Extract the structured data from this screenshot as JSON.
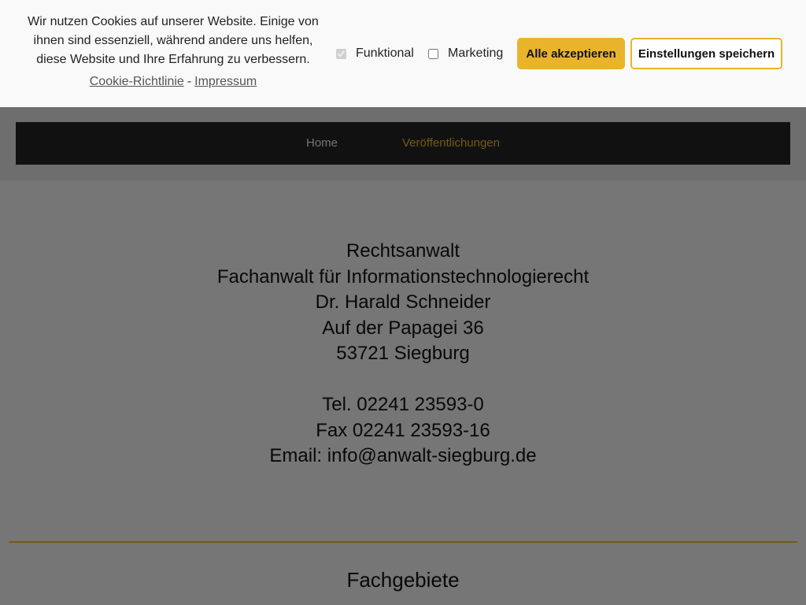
{
  "cookie_banner": {
    "text_lines": [
      "Wir nutzen Cookies auf unserer Website. Einige von",
      "ihnen sind essenziell, während andere uns helfen,",
      "diese Website und Ihre Erfahrung zu verbessern."
    ],
    "links": {
      "policy": "Cookie-Richtlinie",
      "separator": "-",
      "imprint": "Impressum"
    },
    "options": {
      "functional": {
        "label": "Funktional",
        "checked": true,
        "disabled": true
      },
      "marketing": {
        "label": "Marketing",
        "checked": false
      }
    },
    "buttons": {
      "accept_all": "Alle akzeptieren",
      "save_settings": "Einstellungen speichern"
    }
  },
  "nav": {
    "home": "Home",
    "publications": "Veröffentlichungen"
  },
  "contact": {
    "title": "Rechtsanwalt",
    "specialty": "Fachanwalt für Informationstechnologierecht",
    "name": "Dr. Harald Schneider",
    "street": "Auf der Papagei 36",
    "city": "53721 Siegburg",
    "phone": "Tel. 02241 23593-0",
    "fax": "Fax 02241 23593-16",
    "email": "Email: info@anwalt-siegburg.de"
  },
  "sections": {
    "fields_title": "Fachgebiete"
  },
  "colors": {
    "accent": "#e9b42c",
    "navbar": "#222222",
    "banner_bg": "#f9f9f9"
  }
}
